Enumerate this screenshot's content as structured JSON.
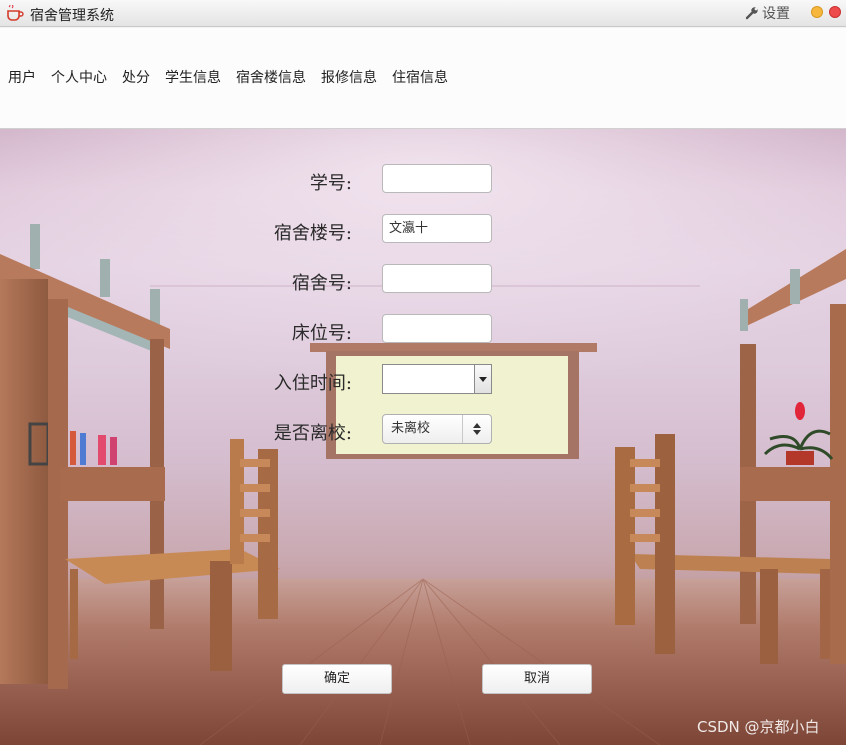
{
  "window": {
    "title": "宿舍管理系统",
    "settings_label": "设置"
  },
  "menu": [
    "用户",
    "个人中心",
    "处分",
    "学生信息",
    "宿舍楼信息",
    "报修信息",
    "住宿信息"
  ],
  "form": {
    "student_id": {
      "label": "学号:",
      "value": ""
    },
    "building": {
      "label": "宿舍楼号:",
      "value": "文瀛十"
    },
    "room": {
      "label": "宿舍号:",
      "value": ""
    },
    "bed": {
      "label": "床位号:",
      "value": ""
    },
    "checkin_time": {
      "label": "入住时间:",
      "value": ""
    },
    "left_school": {
      "label": "是否离校:",
      "value": "未离校"
    }
  },
  "buttons": {
    "confirm": "确定",
    "cancel": "取消"
  },
  "watermark": "CSDN @京都小白"
}
